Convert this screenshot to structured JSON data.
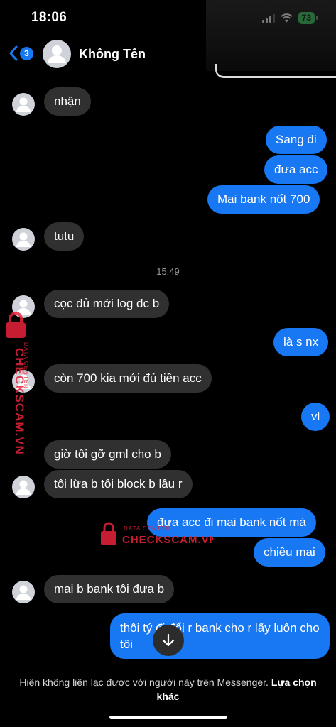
{
  "status": {
    "time": "18:06",
    "battery": "73"
  },
  "header": {
    "unread_count": "3",
    "contact_name": "Không Tên"
  },
  "timestamp": "15:49",
  "messages": [
    {
      "text": "nhận"
    },
    {
      "text": "Sang đi"
    },
    {
      "text": "đưa acc"
    },
    {
      "text": "Mai bank nốt 700"
    },
    {
      "text": "tutu"
    },
    {
      "text": "cọc đủ mới log đc b"
    },
    {
      "text": "là s nx"
    },
    {
      "text": "còn 700 kia mới đủ tiền acc"
    },
    {
      "text": "vl"
    },
    {
      "text": "giờ tôi gỡ gml cho b"
    },
    {
      "text": "tôi lừa b tôi block b lâu r"
    },
    {
      "text": "đưa acc đi mai bank nốt mà"
    },
    {
      "text": "chiều mai"
    },
    {
      "text": "mai b bank tôi đưa b"
    },
    {
      "text": "thôi tý đi đổi r bank cho r lấy luôn cho tôi"
    }
  ],
  "watermark": {
    "brand": "CHECKSCAM.VN",
    "tag": "DATA CENTER"
  },
  "footer": {
    "notice": "Hiện không liên lạc được với người này trên Messenger. ",
    "link": "Lựa chọn khác"
  },
  "colors": {
    "outgoing": "#1877f2",
    "incoming": "#303030",
    "background": "#000000",
    "watermark": "#e8233a"
  }
}
